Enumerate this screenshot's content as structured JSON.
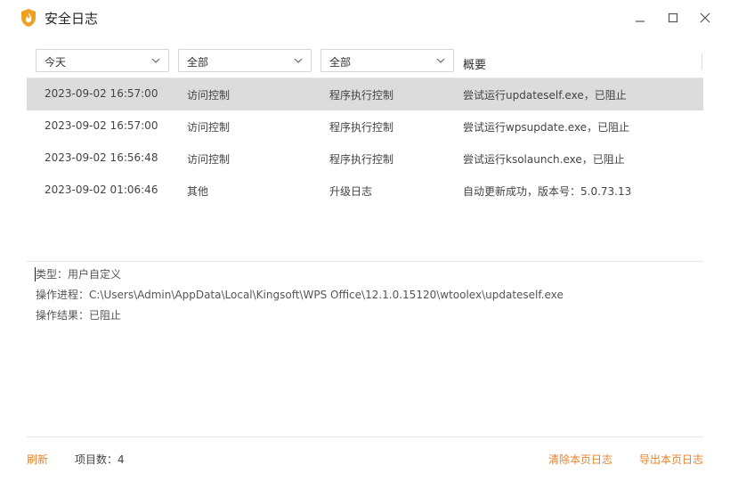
{
  "window": {
    "title": "安全日志"
  },
  "filters": {
    "time": "今天",
    "category": "全部",
    "type": "全部",
    "summary_header": "概要"
  },
  "rows": [
    {
      "time": "2023-09-02 16:57:00",
      "category": "访问控制",
      "type": "程序执行控制",
      "summary": "尝试运行updateself.exe，已阻止"
    },
    {
      "time": "2023-09-02 16:57:00",
      "category": "访问控制",
      "type": "程序执行控制",
      "summary": "尝试运行wpsupdate.exe，已阻止"
    },
    {
      "time": "2023-09-02 16:56:48",
      "category": "访问控制",
      "type": "程序执行控制",
      "summary": "尝试运行ksolaunch.exe，已阻止"
    },
    {
      "time": "2023-09-02 01:06:46",
      "category": "其他",
      "type": "升级日志",
      "summary": "自动更新成功，版本号：5.0.73.13"
    }
  ],
  "detail": {
    "type_line": "类型：用户自定义",
    "process_line": "操作进程：C:\\Users\\Admin\\AppData\\Local\\Kingsoft\\WPS Office\\12.1.0.15120\\wtoolex\\updateself.exe",
    "result_line": "操作结果：已阻止"
  },
  "footer": {
    "refresh": "刷新",
    "count": "项目数：4",
    "clear_page": "清除本页日志",
    "export_page": "导出本页日志"
  },
  "colors": {
    "accent": "#e8822a",
    "selected_row": "#dcdcdc",
    "icon_flame": "#f0a020"
  },
  "icons": {
    "app": "flame-shield-icon",
    "minimize": "minimize-icon",
    "maximize": "maximize-icon",
    "close": "close-icon",
    "dropdown": "chevron-down-icon"
  }
}
